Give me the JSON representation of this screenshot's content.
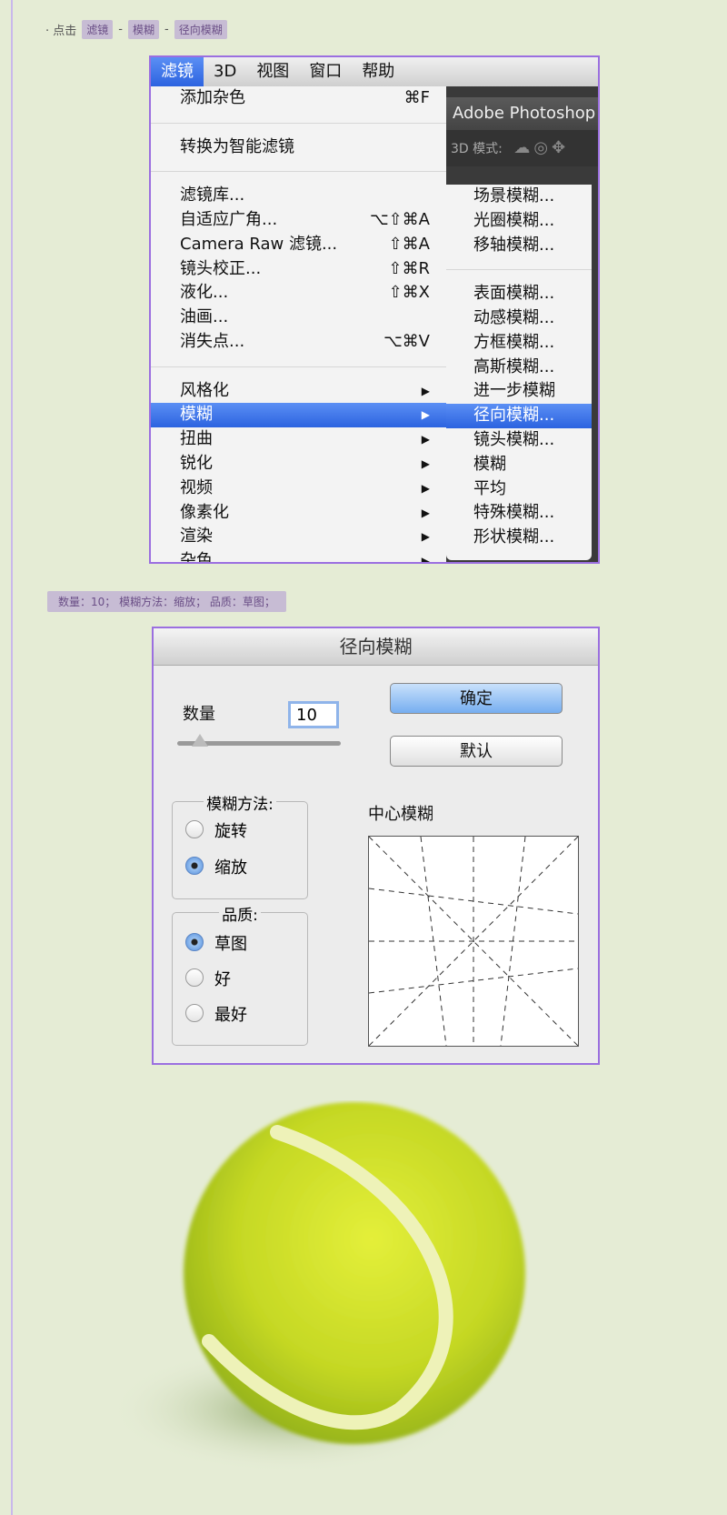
{
  "step": {
    "prefix": "· 点击",
    "tags": [
      "滤镜",
      "模糊",
      "径向模糊"
    ],
    "sep": "-"
  },
  "shot1": {
    "menubar": [
      "滤镜",
      "3D",
      "视图",
      "窗口",
      "帮助"
    ],
    "ps_title": "Adobe Photoshop",
    "ps_mode_label": "3D 模式:",
    "menu": [
      {
        "label": "添加杂色",
        "shortcut": "⌘F"
      },
      {
        "sep": true
      },
      {
        "label": "转换为智能滤镜",
        "shortcut": ""
      },
      {
        "sep": true
      },
      {
        "label": "滤镜库...",
        "shortcut": ""
      },
      {
        "label": "自适应广角...",
        "shortcut": "⌥⇧⌘A"
      },
      {
        "label": "Camera Raw 滤镜...",
        "shortcut": "⇧⌘A"
      },
      {
        "label": "镜头校正...",
        "shortcut": "⇧⌘R"
      },
      {
        "label": "液化...",
        "shortcut": "⇧⌘X"
      },
      {
        "label": "油画...",
        "shortcut": ""
      },
      {
        "label": "消失点...",
        "shortcut": "⌥⌘V"
      },
      {
        "sep": true
      },
      {
        "label": "风格化",
        "shortcut": "▶"
      },
      {
        "label": "模糊",
        "shortcut": "▶",
        "highlight": true
      },
      {
        "label": "扭曲",
        "shortcut": "▶"
      },
      {
        "label": "锐化",
        "shortcut": "▶"
      },
      {
        "label": "视频",
        "shortcut": "▶"
      },
      {
        "label": "像素化",
        "shortcut": "▶"
      },
      {
        "label": "渲染",
        "shortcut": "▶"
      },
      {
        "label": "杂色",
        "shortcut": "▶"
      }
    ],
    "submenu": [
      {
        "label": "场景模糊..."
      },
      {
        "label": "光圈模糊..."
      },
      {
        "label": "移轴模糊..."
      },
      {
        "sep": true
      },
      {
        "label": "表面模糊..."
      },
      {
        "label": "动感模糊..."
      },
      {
        "label": "方框模糊..."
      },
      {
        "label": "高斯模糊..."
      },
      {
        "label": "进一步模糊"
      },
      {
        "label": "径向模糊...",
        "highlight": true
      },
      {
        "label": "镜头模糊..."
      },
      {
        "label": "模糊"
      },
      {
        "label": "平均"
      },
      {
        "label": "特殊模糊..."
      },
      {
        "label": "形状模糊..."
      }
    ]
  },
  "params": "数量：10；   模糊方法：缩放；    品质：草图；",
  "dialog": {
    "title": "径向模糊",
    "amount_label": "数量",
    "amount_value": "10",
    "ok": "确定",
    "default": "默认",
    "method_label": "模糊方法:",
    "method_options": [
      "旋转",
      "缩放"
    ],
    "method_selected": 1,
    "quality_label": "品质:",
    "quality_options": [
      "草图",
      "好",
      "最好"
    ],
    "quality_selected": 0,
    "center_label": "中心模糊"
  },
  "colors": {
    "page_bg": "#e5ecd5",
    "accent_border": "#9b6fe0",
    "menu_highlight": "#3a73ea",
    "tag_bg": "#c7bcd4",
    "ball": "#c8dc2a"
  }
}
